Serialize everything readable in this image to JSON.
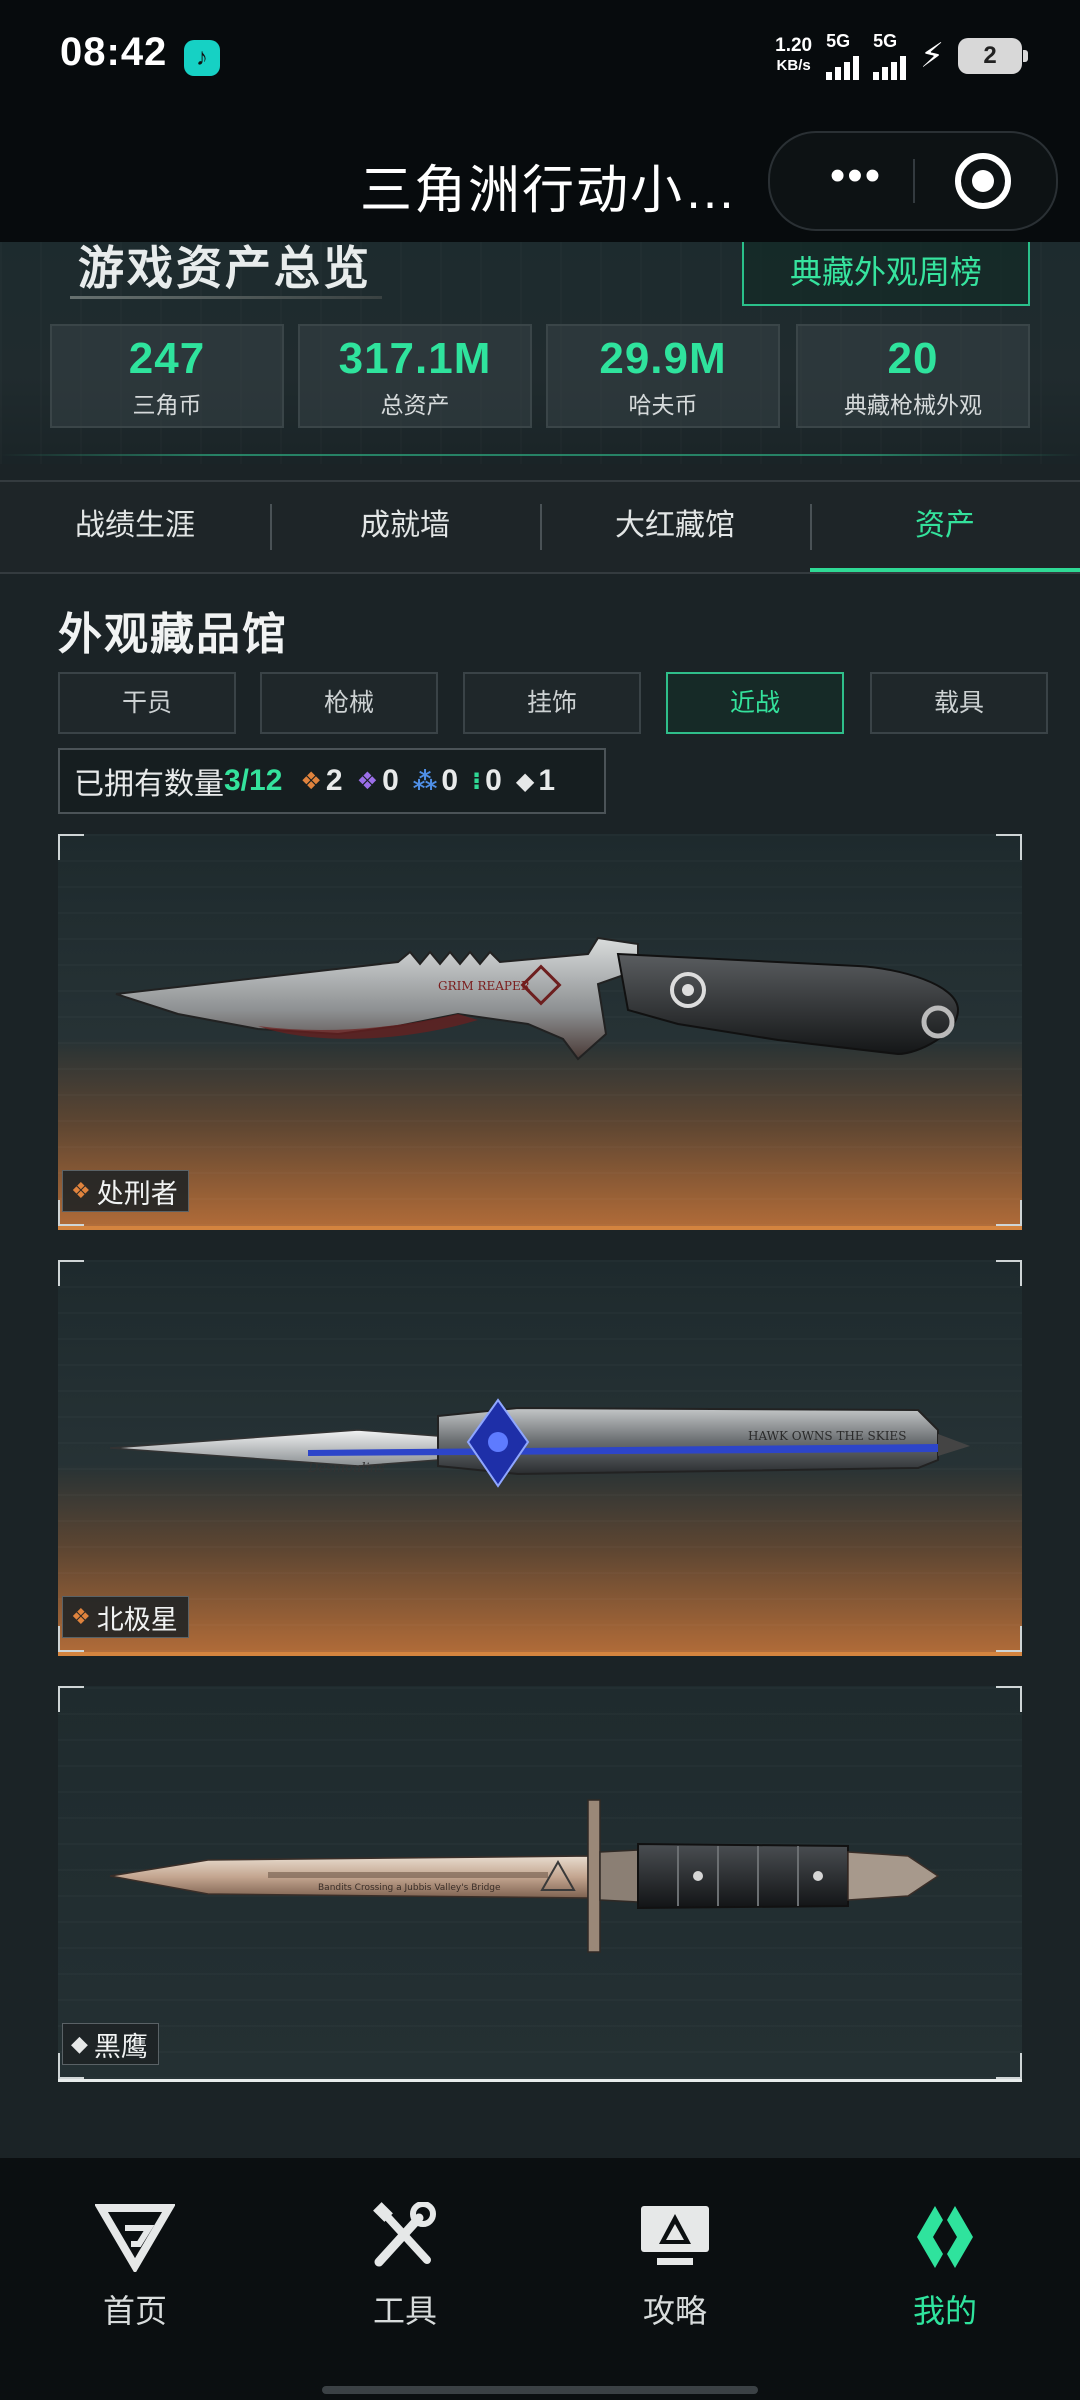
{
  "status_bar": {
    "time": "08:42",
    "net_speed_value": "1.20",
    "net_speed_unit": "KB/s",
    "signal_1_label": "5G",
    "signal_2_label": "5G",
    "battery_level": "2",
    "icons": [
      "music-app-icon",
      "signal-icon",
      "charging-icon",
      "battery-icon"
    ]
  },
  "title_bar": {
    "title": "三角洲行动小…",
    "more_symbol": "•••"
  },
  "overview": {
    "heading": "游戏资产总览",
    "weekly_rank_label": "典藏外观周榜",
    "stats": [
      {
        "value": "247",
        "label": "三角币"
      },
      {
        "value": "317.1M",
        "label": "总资产"
      },
      {
        "value": "29.9M",
        "label": "哈夫币"
      },
      {
        "value": "20",
        "label": "典藏枪械外观"
      }
    ]
  },
  "tabs": [
    {
      "label": "战绩生涯",
      "active": false
    },
    {
      "label": "成就墙",
      "active": false
    },
    {
      "label": "大红藏馆",
      "active": false
    },
    {
      "label": "资产",
      "active": true
    }
  ],
  "collection": {
    "title": "外观藏品馆",
    "filters": [
      {
        "label": "干员",
        "active": false
      },
      {
        "label": "枪械",
        "active": false
      },
      {
        "label": "挂饰",
        "active": false
      },
      {
        "label": "近战",
        "active": true
      },
      {
        "label": "载具",
        "active": false
      }
    ],
    "owned_label": "已拥有数量",
    "owned_count": "3/12",
    "rarity_counts": [
      {
        "icon": "orange-gem-icon",
        "color": "#e0833d",
        "count": "2"
      },
      {
        "icon": "purple-gem-icon",
        "color": "#9b6ee8",
        "count": "0"
      },
      {
        "icon": "blue-gem-icon",
        "color": "#4f8fe6",
        "count": "0"
      },
      {
        "icon": "green-gem-icon",
        "color": "#2fd995",
        "count": "0"
      },
      {
        "icon": "white-gem-icon",
        "color": "#e6e8e8",
        "count": "1"
      }
    ],
    "items": [
      {
        "name": "处刑者",
        "rarity_color": "#e0833d",
        "engraving": "GRIM REAPER"
      },
      {
        "name": "北极星",
        "rarity_color": "#e0833d",
        "engraving_1": "Desmoulins",
        "engraving_2": "HAWK OWNS THE SKIES"
      },
      {
        "name": "黑鹰",
        "rarity_color": "#e6e8e8",
        "engraving": "Bandits Crossing a Jubbis Valley's Bridge"
      }
    ]
  },
  "bottom_nav": [
    {
      "label": "首页",
      "icon": "home-logo-icon",
      "active": false
    },
    {
      "label": "工具",
      "icon": "tools-icon",
      "active": false
    },
    {
      "label": "攻略",
      "icon": "guide-monitor-icon",
      "active": false
    },
    {
      "label": "我的",
      "icon": "profile-logo-icon",
      "active": true
    }
  ],
  "colors": {
    "accent": "#2fe39d",
    "background": "#1b2326",
    "gold_rarity": "#e0833d"
  }
}
